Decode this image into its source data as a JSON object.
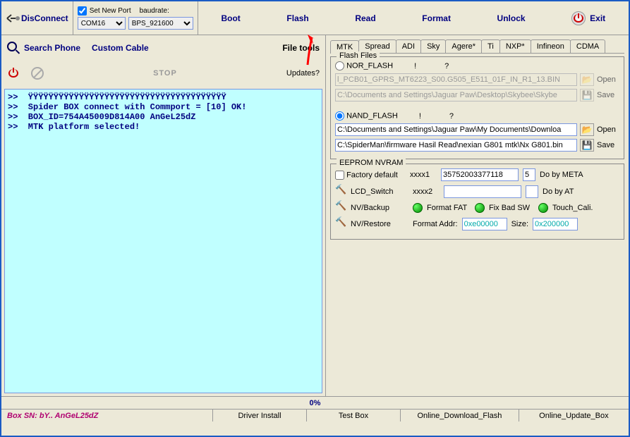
{
  "toolbar": {
    "disconnect": "DisConnect",
    "set_new_port": "Set New Port",
    "baudrate": "baudrate:",
    "port": "COM16",
    "baud": "BPS_921600",
    "boot": "Boot",
    "flash": "Flash",
    "read": "Read",
    "format": "Format",
    "unlock": "Unlock",
    "exit": "Exit"
  },
  "left": {
    "search_phone": "Search Phone",
    "custom_cable": "Custom Cable",
    "file_tools": "File tools",
    "stop": "STOP",
    "updates": "Updates?",
    "log": ">>  ŸŸŸŸŸŸŸŸŸŸŸŸŸŸŸŸŸŸŸŸŸŸŸŸŸŸŸŸŸŸŸŸŸŸŸŸŸŸŸ\n>>  Spider BOX connect with Commport = [10] OK!\n>>  BOX_ID=754A45009D814A00 AnGeL25dZ\n>>  MTK platform selected!"
  },
  "tabs": [
    "MTK",
    "Spread",
    "ADI",
    "Sky",
    "Agere*",
    "Ti",
    "NXP*",
    "Infineon",
    "CDMA"
  ],
  "flash": {
    "title": "Flash Files",
    "nor": "NOR_FLASH",
    "nand": "NAND_FLASH",
    "nor_path1": "l_PCB01_GPRS_MT6223_S00.G505_E511_01F_IN_R1_13.BIN",
    "nor_path2": "C:\\Documents and Settings\\Jaguar Paw\\Desktop\\Skybee\\Skybe",
    "nand_path1": "C:\\Documents and Settings\\Jaguar Paw\\My Documents\\Downloa",
    "nand_path2": "C:\\SpiderMan\\firmware Hasil Read\\nexian G801 mtk\\Nx G801.bin",
    "open": "Open",
    "save": "Save",
    "q1": "!",
    "q2": "?"
  },
  "eeprom": {
    "title": "EEPROM NVRAM",
    "factory": "Factory default",
    "xxxx1": "xxxx1",
    "xxxx1_val": "35752003377118",
    "xxxx1_n": "5",
    "do_meta": "Do by META",
    "lcd_switch": "LCD_Switch",
    "xxxx2": "xxxx2",
    "do_at": "Do by AT",
    "nv_backup": "NV/Backup",
    "format_fat": "Format FAT",
    "fix_bad_sw": "Fix Bad SW",
    "touch_cali": "Touch_Cali.",
    "nv_restore": "NV/Restore",
    "format_addr": "Format Addr:",
    "addr_val": "0xe00000",
    "size": "Size:",
    "size_val": "0x200000"
  },
  "bottom": {
    "progress": "0%",
    "box_sn": "Box SN: bY.. AnGeL25dZ",
    "driver": "Driver Install",
    "test": "Test Box",
    "online_dl": "Online_Download_Flash",
    "online_up": "Online_Update_Box"
  }
}
